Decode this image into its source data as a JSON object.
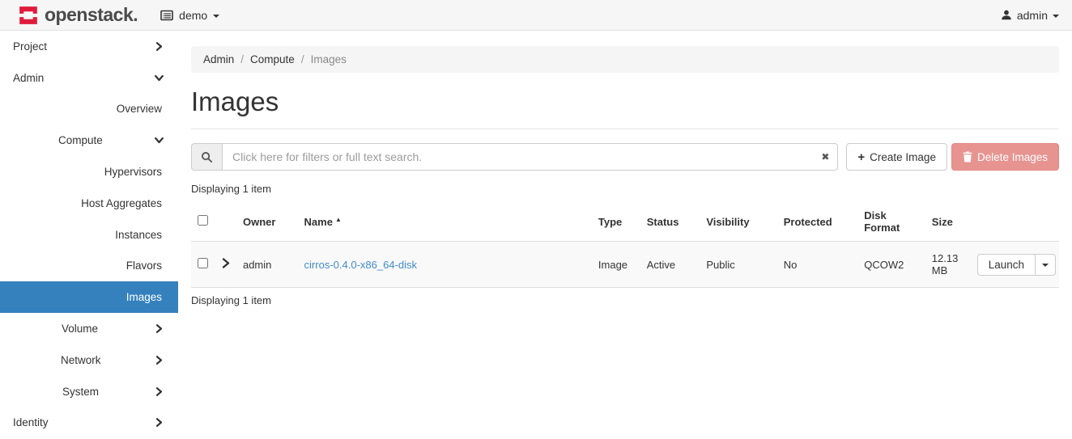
{
  "topbar": {
    "brand": "openstack.",
    "project_switcher": {
      "label": "demo"
    },
    "user_menu": {
      "label": "admin"
    }
  },
  "sidebar": {
    "items": [
      {
        "label": "Project"
      },
      {
        "label": "Admin"
      },
      {
        "label": "Overview"
      },
      {
        "label": "Compute"
      },
      {
        "label": "Hypervisors"
      },
      {
        "label": "Host Aggregates"
      },
      {
        "label": "Instances"
      },
      {
        "label": "Flavors"
      },
      {
        "label": "Images",
        "active": true
      },
      {
        "label": "Volume"
      },
      {
        "label": "Network"
      },
      {
        "label": "System"
      },
      {
        "label": "Identity"
      }
    ]
  },
  "breadcrumb": {
    "items": [
      "Admin",
      "Compute",
      "Images"
    ]
  },
  "page": {
    "title": "Images"
  },
  "filter": {
    "placeholder": "Click here for filters or full text search."
  },
  "toolbar": {
    "create_label": "Create Image",
    "delete_label": "Delete Images"
  },
  "table": {
    "count_top": "Displaying 1 item",
    "count_bottom": "Displaying 1 item",
    "headers": [
      "Owner",
      "Name",
      "Type",
      "Status",
      "Visibility",
      "Protected",
      "Disk Format",
      "Size"
    ],
    "rows": [
      {
        "owner": "admin",
        "name": "cirros-0.4.0-x86_64-disk",
        "type": "Image",
        "status": "Active",
        "visibility": "Public",
        "protected": "No",
        "disk_format": "QCOW2",
        "size": "12.13 MB",
        "action": "Launch"
      }
    ]
  },
  "icons": {
    "sort_asc": "▲",
    "clear": "✖",
    "plus": "+"
  },
  "colors": {
    "brand_red": "#e01b3c",
    "active_blue": "#3481be",
    "link_blue": "#428bca",
    "danger_red": "#d9534f",
    "topbar_bg": "#f6f6f6"
  }
}
